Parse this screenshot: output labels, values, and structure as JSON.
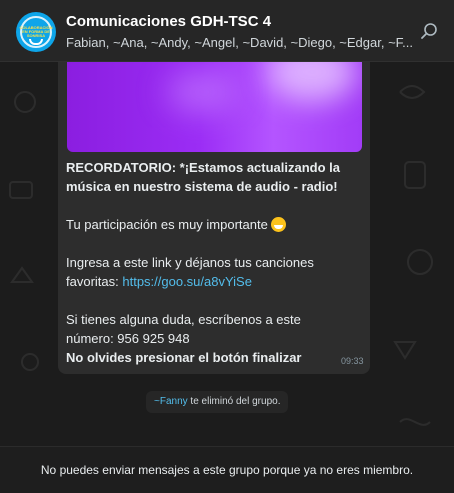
{
  "header": {
    "title": "Comunicaciones GDH-TSC 4",
    "members": "Fabian, ~Ana, ~Andy, ~Angel, ~David, ~Diego, ~Edgar, ~F...",
    "avatar_text": "COLABORACIÓN EN FORMA DE SONRISA",
    "icons": {
      "search": "search-icon"
    }
  },
  "message": {
    "line1": "RECORDATORIO: *¡Estamos actualizando la",
    "line2": "música en nuestro sistema de audio - radio!",
    "line3": "Tu participación es muy importante",
    "emoji": "grinning-face-emoji",
    "line4": "Ingresa a este link y déjanos tus canciones",
    "line5_prefix": "favoritas: ",
    "link": "https://goo.su/a8vYiSe",
    "line6": "Si tienes alguna duda, escríbenos a este",
    "line7": "número: 956 925 948",
    "line8": "No olvides presionar el botón finalizar",
    "time": "09:33"
  },
  "system_notice": {
    "actor": "~Fanny",
    "text": " te eliminó del grupo."
  },
  "footer": {
    "text": "No puedes enviar mensajes a este grupo porque ya no eres miembro."
  },
  "colors": {
    "accent_link": "#53bdeb",
    "bubble": "#2d2d2d",
    "background": "#1c1c1c"
  }
}
